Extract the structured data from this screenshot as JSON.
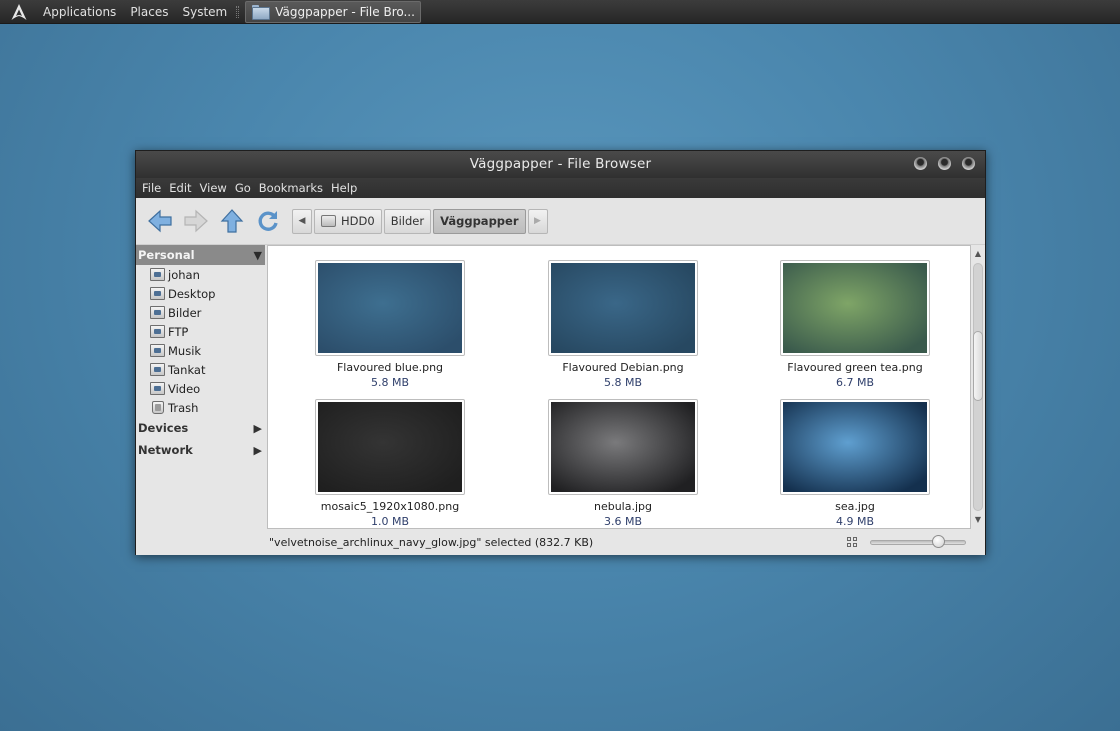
{
  "panel": {
    "menus": [
      "Applications",
      "Places",
      "System"
    ],
    "task_title": "Väggpapper - File Bro..."
  },
  "window": {
    "title": "Väggpapper - File Browser",
    "menubar": [
      "File",
      "Edit",
      "View",
      "Go",
      "Bookmarks",
      "Help"
    ],
    "toolbar": {
      "icons": [
        "back-arrow-icon",
        "forward-arrow-icon",
        "up-arrow-icon",
        "reload-icon"
      ],
      "breadcrumbs": [
        "HDD0",
        "Bilder",
        "Väggpapper"
      ]
    }
  },
  "sidebar": {
    "personal": {
      "label": "Personal",
      "items": [
        {
          "label": "johan",
          "icon": "home-folder-icon"
        },
        {
          "label": "Desktop",
          "icon": "desktop-folder-icon"
        },
        {
          "label": "Bilder",
          "icon": "pictures-folder-icon"
        },
        {
          "label": "FTP",
          "icon": "ftp-folder-icon"
        },
        {
          "label": "Musik",
          "icon": "music-folder-icon"
        },
        {
          "label": "Tankat",
          "icon": "downloads-folder-icon"
        },
        {
          "label": "Video",
          "icon": "video-folder-icon"
        },
        {
          "label": "Trash",
          "icon": "trash-icon"
        }
      ]
    },
    "devices": {
      "label": "Devices"
    },
    "network": {
      "label": "Network"
    }
  },
  "files": [
    {
      "name": "Flavoured blue.png",
      "size": "5.8 MB",
      "colors": [
        "#3e6f90",
        "#2c4e6b"
      ]
    },
    {
      "name": "Flavoured Debian.png",
      "size": "5.8 MB",
      "colors": [
        "#3a6788",
        "#274861"
      ]
    },
    {
      "name": "Flavoured green tea.png",
      "size": "6.7 MB",
      "colors": [
        "#7fa567",
        "#3a5a4c"
      ]
    },
    {
      "name": "mosaic5_1920x1080.png",
      "size": "1.0 MB",
      "colors": [
        "#343434",
        "#1f1f1f"
      ]
    },
    {
      "name": "nebula.jpg",
      "size": "3.6 MB",
      "colors": [
        "#7a7a7c",
        "#202022"
      ]
    },
    {
      "name": "sea.jpg",
      "size": "4.9 MB",
      "colors": [
        "#5f9fd0",
        "#14304e"
      ]
    }
  ],
  "statusbar": {
    "text": "\"velvetnoise_archlinux_navy_glow.jpg\" selected (832.7 KB)",
    "zoom_level": 0.75
  }
}
